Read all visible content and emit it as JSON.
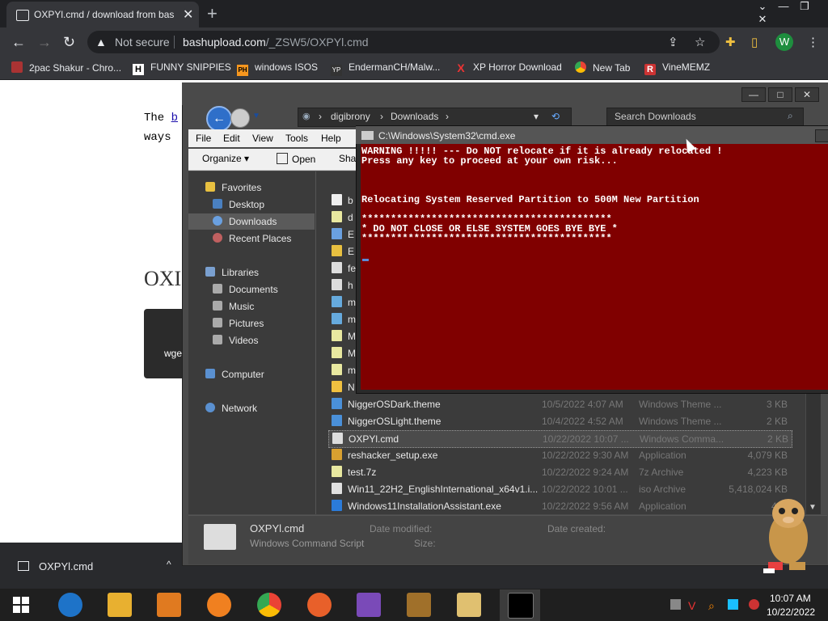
{
  "browser": {
    "tab_title": "OXPYl.cmd / download from bas",
    "new_tab": "+",
    "tab_close": "✕",
    "window_controls": [
      "⌄",
      "—",
      "❐",
      "✕"
    ],
    "not_secure": "Not secure",
    "url_domain": "bashupload.com",
    "url_path": "/_ZSW5/OXPYl.cmd",
    "avatar_letter": "W",
    "bookmarks": [
      {
        "label": "2pac Shakur - Chro...",
        "icon": "2pac-favicon"
      },
      {
        "label": "FUNNY SNIPPIES",
        "icon": "H"
      },
      {
        "label": "windows ISOS",
        "icon": "PH"
      },
      {
        "label": "EndermanCH/Malw...",
        "icon": "YP"
      },
      {
        "label": "XP Horror Download",
        "icon": "X"
      },
      {
        "label": "New Tab",
        "icon": "chrome-favicon"
      },
      {
        "label": "VineMEMZ",
        "icon": "R"
      }
    ]
  },
  "page": {
    "line1_prefix": "The ",
    "line1_link": "b",
    "line2": "ways",
    "heading": "OXI",
    "code_snippet": "wge"
  },
  "download_shelf": {
    "file_name": "OXPYl.cmd",
    "chevron": "^"
  },
  "explorer": {
    "breadcrumbs": [
      "digibrony",
      "Downloads"
    ],
    "search_placeholder": "Search Downloads",
    "menu": [
      "File",
      "Edit",
      "View",
      "Tools",
      "Help"
    ],
    "commands": [
      "Organize ▾",
      "Open",
      "Sha"
    ],
    "nav": {
      "favorites": "Favorites",
      "desktop": "Desktop",
      "downloads": "Downloads",
      "recent": "Recent Places",
      "libraries": "Libraries",
      "documents": "Documents",
      "music": "Music",
      "pictures": "Pictures",
      "videos": "Videos",
      "computer": "Computer",
      "network": "Network"
    },
    "partial_rows": [
      "b",
      "d",
      "E",
      "E",
      "fe",
      "h",
      "m",
      "m",
      "M",
      "M",
      "m",
      "N"
    ],
    "files": [
      {
        "name": "NiggerOSDark.theme",
        "date": "10/5/2022 4:07 AM",
        "type": "Windows Theme ...",
        "size": "3 KB",
        "color": "#4a90d9"
      },
      {
        "name": "NiggerOSLight.theme",
        "date": "10/4/2022 4:52 AM",
        "type": "Windows Theme ...",
        "size": "2 KB",
        "color": "#4a90d9"
      },
      {
        "name": "OXPYl.cmd",
        "date": "10/22/2022 10:07 ...",
        "type": "Windows Comma...",
        "size": "2 KB",
        "color": "#dddddd"
      },
      {
        "name": "reshacker_setup.exe",
        "date": "10/22/2022 9:30 AM",
        "type": "Application",
        "size": "4,079 KB",
        "color": "#d9a030"
      },
      {
        "name": "test.7z",
        "date": "10/22/2022 9:24 AM",
        "type": "7z Archive",
        "size": "4,223 KB",
        "color": "#e8e8a0"
      },
      {
        "name": "Win11_22H2_EnglishInternational_x64v1.i...",
        "date": "10/22/2022 10:01 ...",
        "type": "iso Archive",
        "size": "5,418,024 KB",
        "color": "#e0e0e0"
      },
      {
        "name": "Windows11InstallationAssistant.exe",
        "date": "10/22/2022 9:56 AM",
        "type": "Application",
        "size": "4,...",
        "color": "#2b7bd9"
      }
    ],
    "details": {
      "name": "OXPYl.cmd",
      "type": "Windows Command Script",
      "date_modified_label": "Date modified:",
      "date_created_label": "Date created:",
      "size_label": "Size:"
    }
  },
  "cmd": {
    "title": "C:\\Windows\\System32\\cmd.exe",
    "lines": [
      "WARNING !!!!! --- Do NOT relocate if it is already relocated !",
      "Press any key to proceed at your own risk...",
      "Relocating System Reserved Partition to 500M New Partition",
      "*******************************************",
      "* DO NOT CLOSE OR ELSE SYSTEM GOES BYE BYE *",
      "*******************************************"
    ]
  },
  "taskbar": {
    "time": "10:07 AM",
    "date": "10/22/2022",
    "apps": [
      "start-icon",
      "internet-explorer-icon",
      "file-explorer-icon",
      "media-player-icon",
      "uc-browser-icon",
      "chrome-icon",
      "firefox-icon",
      "visual-studio-icon",
      "bonzibuddy-icon",
      "archive-icon",
      "cmd-icon"
    ]
  },
  "colors": {
    "console_bg": "#800000",
    "chrome_dark": "#35363a",
    "explorer_dark": "#3b3b3b"
  }
}
